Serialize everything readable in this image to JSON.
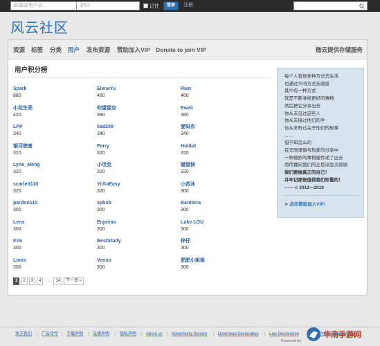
{
  "topbar": {
    "email_placeholder": "邮箱或用户名：",
    "password_placeholder": "密码：",
    "remember_label": "记住",
    "login_label": "登录",
    "register_label": "注册"
  },
  "site": {
    "logo": "风云社区"
  },
  "nav": {
    "items": [
      "资源",
      "标签",
      "分类",
      "用户",
      "发布资源",
      "赞助加入VIP",
      "Donate to join VIP"
    ],
    "active": "用户",
    "right": "微云提供存储服务"
  },
  "ranking": {
    "title": "用户积分榜",
    "users": [
      {
        "name": "Spark",
        "score": "880"
      },
      {
        "name": "ElenaYu",
        "score": "460"
      },
      {
        "name": "Rain",
        "score": "460"
      },
      {
        "name": "小花生壳",
        "score": "420"
      },
      {
        "name": "仰望星空",
        "score": "380"
      },
      {
        "name": "Ewali",
        "score": "380"
      },
      {
        "name": "LPP",
        "score": "340"
      },
      {
        "name": "liad209",
        "score": "340"
      },
      {
        "name": "爱码农",
        "score": "340"
      },
      {
        "name": "银河使者",
        "score": "320"
      },
      {
        "name": "Parry",
        "score": "320"
      },
      {
        "name": "Hobbit",
        "score": "320"
      },
      {
        "name": "Lynn_Meng",
        "score": "320"
      },
      {
        "name": "小坦克",
        "score": "320"
      },
      {
        "name": "键盘侠",
        "score": "320"
      },
      {
        "name": "scarlett110",
        "score": "320"
      },
      {
        "name": "YiiSoEasy",
        "score": "320"
      },
      {
        "name": "小苏沐",
        "score": "300"
      },
      {
        "name": "pardon110",
        "score": "300"
      },
      {
        "name": "xpbob",
        "score": "300"
      },
      {
        "name": "Bantorra",
        "score": "300"
      },
      {
        "name": "Lens",
        "score": "300"
      },
      {
        "name": "Enjoiras",
        "score": "300"
      },
      {
        "name": "Luke LOU",
        "score": "300"
      },
      {
        "name": "Kim",
        "score": "300"
      },
      {
        "name": "BestStudy",
        "score": "300"
      },
      {
        "name": "梓仔",
        "score": "300"
      },
      {
        "name": "Louis",
        "score": "300"
      },
      {
        "name": "Venus",
        "score": "300"
      },
      {
        "name": "肥肥小姐姐",
        "score": "300"
      }
    ]
  },
  "pagination": {
    "pages": [
      "1",
      "2",
      "3",
      "4"
    ],
    "current": "1",
    "ellipsis": "...",
    "last": "14",
    "next": "下一页 »"
  },
  "quote": {
    "lines": [
      "每个人有很多种方式去生活",
      "也通过不同方式去感恩",
      "其中有一种方式",
      "就是不断寻找更好的事物",
      "然后把它分享出去",
      "你从未见过这些人",
      "你从未接过他们的手",
      "你从未听过关于他们的故事",
      "... ...",
      "但不知怎么的",
      "在无限谨慎与热爱的分享中",
      "一种微妙的事物被传递了出去",
      "而传播向我们的正是深层次感谢",
      "我们要做真正的自己！",
      "并牢记那些值得我们珍重的！",
      "—— © 2012～2019"
    ],
    "bold_from": 13,
    "sponsor": "➤ 点击赞助加入VIP!"
  },
  "footer": {
    "links": [
      "关于我们",
      "广告合作",
      "下载声明",
      "法律声明",
      "隐私声明",
      "About us",
      "Advertising Service",
      "Download Declaration",
      "Law Declaration",
      "Privacy Declaration"
    ],
    "powered": "Powered by",
    "watermark": "华南手游网"
  }
}
